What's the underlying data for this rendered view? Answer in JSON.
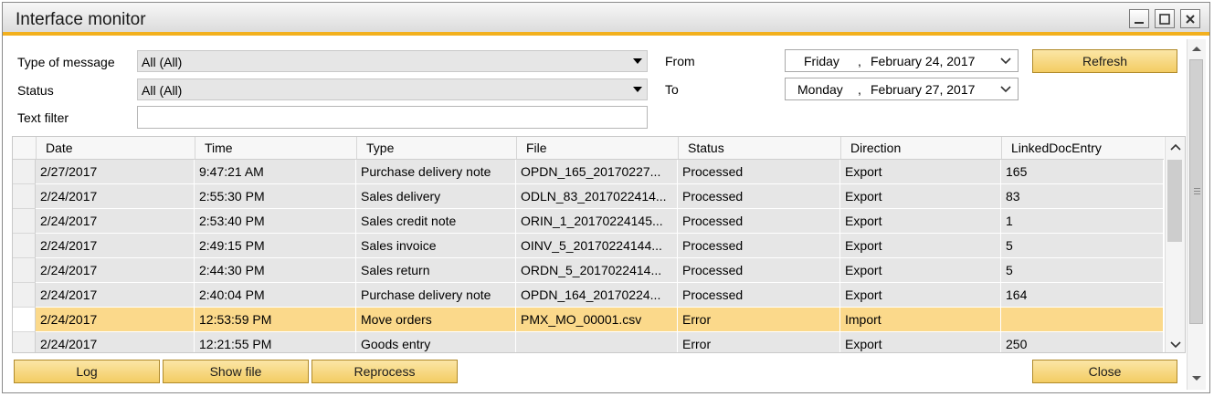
{
  "window": {
    "title": "Interface monitor"
  },
  "filters": {
    "type_label": "Type of message",
    "type_value": "All (All)",
    "status_label": "Status",
    "status_value": "All (All)",
    "text_label": "Text filter",
    "text_value": "",
    "from_label": "From",
    "from_weekday": "Friday",
    "from_date": "February  24, 2017",
    "to_label": "To",
    "to_weekday": "Monday",
    "to_date": "February  27, 2017",
    "date_sep": ","
  },
  "buttons": {
    "refresh": "Refresh",
    "log": "Log",
    "show_file": "Show file",
    "reprocess": "Reprocess",
    "close": "Close"
  },
  "grid": {
    "columns": [
      "Date",
      "Time",
      "Type",
      "File",
      "Status",
      "Direction",
      "LinkedDocEntry"
    ],
    "rows": [
      [
        "2/27/2017",
        "9:47:21 AM",
        "Purchase delivery note",
        "OPDN_165_20170227...",
        "Processed",
        "Export",
        "165"
      ],
      [
        "2/24/2017",
        "2:55:30 PM",
        "Sales delivery",
        "ODLN_83_2017022414...",
        "Processed",
        "Export",
        "83"
      ],
      [
        "2/24/2017",
        "2:53:40 PM",
        "Sales credit note",
        "ORIN_1_20170224145...",
        "Processed",
        "Export",
        "1"
      ],
      [
        "2/24/2017",
        "2:49:15 PM",
        "Sales invoice",
        "OINV_5_20170224144...",
        "Processed",
        "Export",
        "5"
      ],
      [
        "2/24/2017",
        "2:44:30 PM",
        "Sales return",
        "ORDN_5_2017022414...",
        "Processed",
        "Export",
        "5"
      ],
      [
        "2/24/2017",
        "2:40:04 PM",
        "Purchase delivery note",
        "OPDN_164_20170224...",
        "Processed",
        "Export",
        "164"
      ],
      [
        "2/24/2017",
        "12:53:59 PM",
        "Move orders",
        "PMX_MO_00001.csv",
        "Error",
        "Import",
        ""
      ],
      [
        "2/24/2017",
        "12:21:55 PM",
        "Goods entry",
        "",
        "Error",
        "Export",
        "250"
      ]
    ],
    "selected_row": 6
  },
  "colors": {
    "accent": "#f2b01e",
    "button": "#f3cc63",
    "selected_row": "#fbd98b",
    "cell": "#e6e6e6"
  }
}
